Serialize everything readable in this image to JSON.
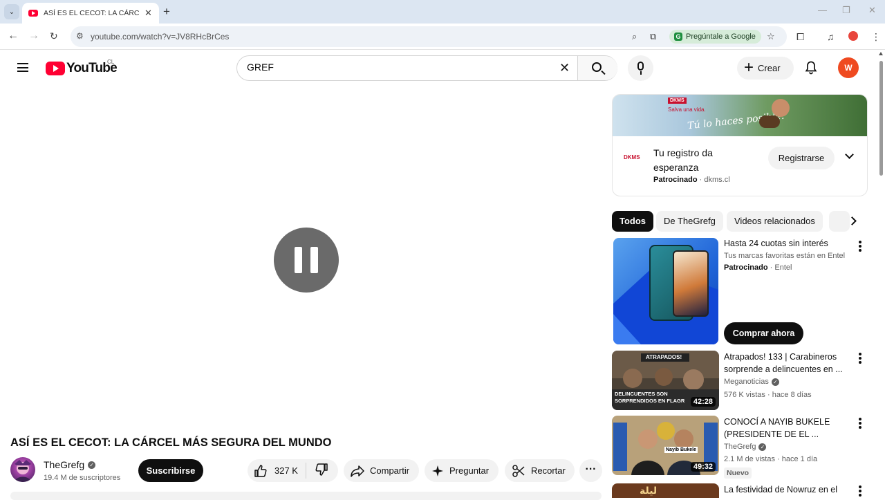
{
  "browser": {
    "tab_title": "ASÍ ES EL CECOT: LA CÁRCEL M",
    "tab_close": "✕",
    "new_tab": "+",
    "url": "youtube.com/watch?v=JV8RHcBrCes",
    "ask_google": "Pregúntale a Google"
  },
  "masthead": {
    "logo_text": "YouTube",
    "country_code": "CL",
    "search_value": "GREF",
    "create_label": "Crear",
    "avatar_letter": "W"
  },
  "video": {
    "title": "ASÍ ES EL CECOT: LA CÁRCEL MÁS SEGURA DEL MUNDO",
    "channel": "TheGrefg",
    "subscribers": "19.4 M de suscriptores",
    "subscribe_label": "Suscribirse",
    "likes": "327 K",
    "share_label": "Compartir",
    "ask_label": "Preguntar",
    "clip_label": "Recortar"
  },
  "ad_card": {
    "brand": "DKMS",
    "banner_line1": "Salva una vida.",
    "banner_line2": "Tú lo haces posible.",
    "logo": "DKMS",
    "title": "Tu registro da esperanza",
    "sponsored": "Patrocinado",
    "domain": "· dkms.cl",
    "cta": "Registrarse"
  },
  "chips": [
    "Todos",
    "De TheGrefg",
    "Videos relacionados"
  ],
  "ad2": {
    "title": "Hasta 24 cuotas sin interés",
    "subtitle": "Tus marcas favoritas están en Entel",
    "sponsored": "Patrocinado",
    "advertiser": "· Entel",
    "cta": "Comprar ahora"
  },
  "recommendations": [
    {
      "title": "Atrapados! 133 | Carabineros sorprende a delincuentes en ...",
      "channel": "Meganoticias",
      "meta": "576 K vistas · hace 8 días",
      "duration": "42:28",
      "thumb_top": "ATRAPADOS!",
      "thumb_bottom": "DELINCUENTES SON SORPRENDIDOS EN FLAGR"
    },
    {
      "title": "CONOCÍ A NAYIB BUKELE (PRESIDENTE DE EL ...",
      "channel": "TheGrefg",
      "meta": "2.1 M de vistas · hace 1 día",
      "duration": "49:32",
      "badge": "Nuevo",
      "thumb_label": "Nayib Bukele"
    },
    {
      "title": "La festividad de Nowruz en el"
    }
  ]
}
